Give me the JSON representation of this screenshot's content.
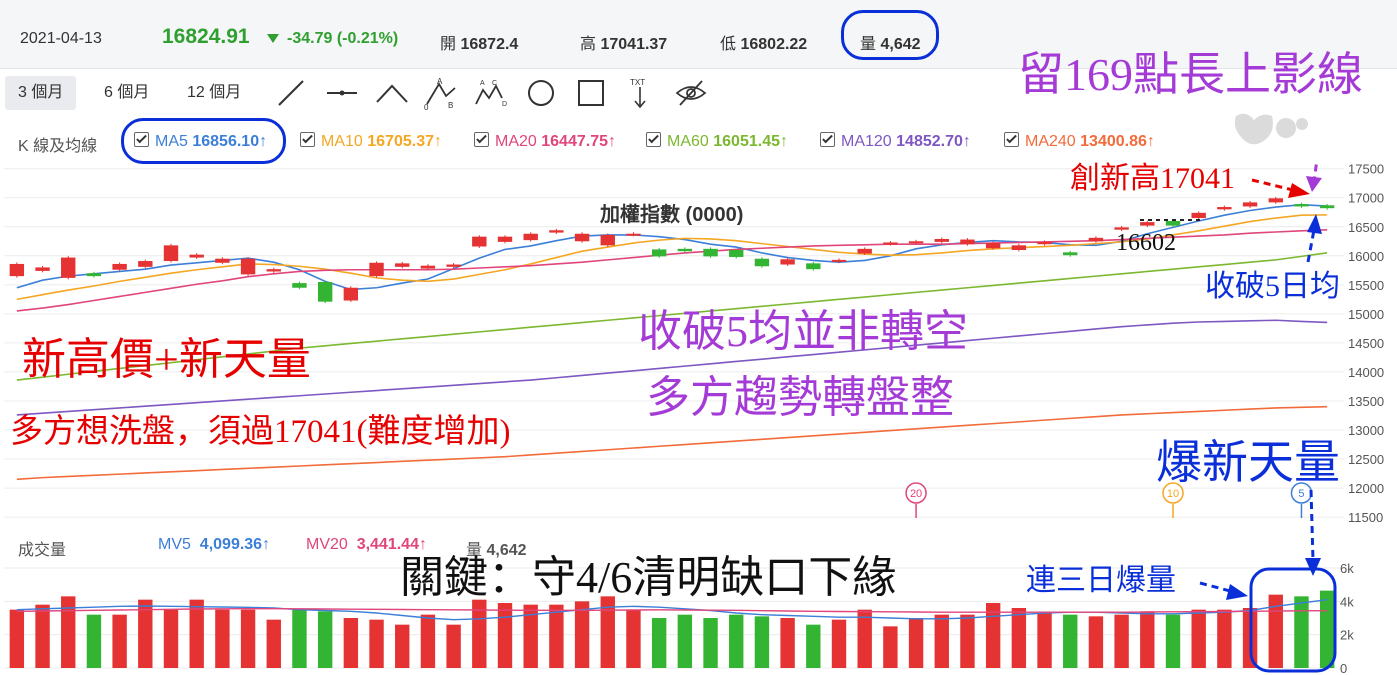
{
  "header": {
    "date": "2021-04-13",
    "price": "16824.91",
    "change": "-34.79 (-0.21%)",
    "open_label": "開",
    "open_value": "16872.4",
    "high_label": "高",
    "high_value": "17041.37",
    "low_label": "低",
    "low_value": "16802.22",
    "volume_label": "量",
    "volume_value": "4,642"
  },
  "toolbar": {
    "ranges": [
      "3 個月",
      "6 個月",
      "12 個月"
    ],
    "active_range": "3 個月",
    "tools": [
      "line-tool-icon",
      "horizontal-line-tool-icon",
      "angle-tool-icon",
      "abcd-pattern-tool-icon",
      "abcde-wave-tool-icon",
      "circle-tool-icon",
      "rectangle-tool-icon",
      "text-tool-icon",
      "hide-drawings-icon"
    ]
  },
  "ma_legend": {
    "title": "K 線及均線",
    "items": [
      {
        "label": "MA5",
        "value": "16856.10↑",
        "color": "#3c7fd8"
      },
      {
        "label": "MA10",
        "value": "16705.37↑",
        "color": "#f5a623"
      },
      {
        "label": "MA20",
        "value": "16447.75↑",
        "color": "#e0457b"
      },
      {
        "label": "MA60",
        "value": "16051.45↑",
        "color": "#7cb82f"
      },
      {
        "label": "MA120",
        "value": "14852.70↑",
        "color": "#7e57c2"
      },
      {
        "label": "MA240",
        "value": "13400.86↑",
        "color": "#f26b3a"
      }
    ]
  },
  "chart_data": {
    "type": "candlestick",
    "title": "加權指數 (0000)",
    "y_ticks": [
      11500,
      12000,
      12500,
      13000,
      13500,
      14000,
      14500,
      15000,
      15500,
      16000,
      16500,
      17000,
      17500
    ],
    "ylim": [
      11450,
      17650
    ],
    "candles": [
      {
        "o": 15650,
        "c": 15860
      },
      {
        "o": 15740,
        "c": 15800
      },
      {
        "o": 15620,
        "c": 15970
      },
      {
        "o": 15700,
        "c": 15650
      },
      {
        "o": 15760,
        "c": 15860
      },
      {
        "o": 15810,
        "c": 15910
      },
      {
        "o": 15910,
        "c": 16180
      },
      {
        "o": 15970,
        "c": 16020
      },
      {
        "o": 15880,
        "c": 15950
      },
      {
        "o": 15680,
        "c": 15950
      },
      {
        "o": 15730,
        "c": 15770
      },
      {
        "o": 15530,
        "c": 15450
      },
      {
        "o": 15550,
        "c": 15210
      },
      {
        "o": 15230,
        "c": 15450
      },
      {
        "o": 15650,
        "c": 15880
      },
      {
        "o": 15810,
        "c": 15870
      },
      {
        "o": 15780,
        "c": 15830
      },
      {
        "o": 15810,
        "c": 15850
      },
      {
        "o": 16160,
        "c": 16330
      },
      {
        "o": 16240,
        "c": 16330
      },
      {
        "o": 16270,
        "c": 16380
      },
      {
        "o": 16400,
        "c": 16440
      },
      {
        "o": 16250,
        "c": 16380
      },
      {
        "o": 16180,
        "c": 16360
      },
      {
        "o": 16360,
        "c": 16380
      },
      {
        "o": 16110,
        "c": 15990
      },
      {
        "o": 16120,
        "c": 16080
      },
      {
        "o": 16120,
        "c": 15990
      },
      {
        "o": 16100,
        "c": 15980
      },
      {
        "o": 15950,
        "c": 15820
      },
      {
        "o": 15850,
        "c": 15940
      },
      {
        "o": 15870,
        "c": 15770
      },
      {
        "o": 15900,
        "c": 15930
      },
      {
        "o": 16040,
        "c": 16120
      },
      {
        "o": 16200,
        "c": 16230
      },
      {
        "o": 16230,
        "c": 16250
      },
      {
        "o": 16240,
        "c": 16290
      },
      {
        "o": 16200,
        "c": 16280
      },
      {
        "o": 16130,
        "c": 16220
      },
      {
        "o": 16100,
        "c": 16180
      },
      {
        "o": 16200,
        "c": 16240
      },
      {
        "o": 16060,
        "c": 16010
      },
      {
        "o": 16250,
        "c": 16310
      },
      {
        "o": 16450,
        "c": 16490
      },
      {
        "o": 16520,
        "c": 16580
      },
      {
        "o": 16600,
        "c": 16520
      },
      {
        "o": 16650,
        "c": 16740
      },
      {
        "o": 16800,
        "c": 16840
      },
      {
        "o": 16850,
        "c": 16920
      },
      {
        "o": 16920,
        "c": 16990
      },
      {
        "o": 16890,
        "c": 16850
      },
      {
        "o": 16870,
        "c": 16820
      }
    ],
    "ma_lines": [
      {
        "name": "MA5",
        "color": "#3c7fd8",
        "values": [
          15450,
          15580,
          15650,
          15690,
          15730,
          15770,
          15840,
          15880,
          15920,
          15960,
          15890,
          15760,
          15560,
          15420,
          15450,
          15530,
          15600,
          15780,
          15960,
          16110,
          16170,
          16260,
          16340,
          16360,
          16360,
          16330,
          16280,
          16200,
          16150,
          16050,
          15970,
          15920,
          15890,
          15920,
          16000,
          16120,
          16190,
          16230,
          16260,
          16240,
          16230,
          16190,
          16180,
          16250,
          16380,
          16490,
          16600,
          16700,
          16780,
          16840,
          16880,
          16856
        ]
      },
      {
        "name": "MA10",
        "color": "#f5a623",
        "values": [
          15250,
          15330,
          15410,
          15480,
          15560,
          15630,
          15700,
          15760,
          15810,
          15860,
          15850,
          15820,
          15770,
          15700,
          15620,
          15580,
          15560,
          15600,
          15680,
          15760,
          15860,
          15970,
          16080,
          16150,
          16220,
          16270,
          16300,
          16290,
          16260,
          16210,
          16160,
          16110,
          16060,
          16030,
          16010,
          16020,
          16050,
          16090,
          16120,
          16140,
          16160,
          16180,
          16210,
          16240,
          16290,
          16360,
          16430,
          16510,
          16590,
          16650,
          16700,
          16705
        ]
      },
      {
        "name": "MA20",
        "color": "#e0457b",
        "values": [
          15050,
          15100,
          15160,
          15230,
          15300,
          15370,
          15440,
          15510,
          15570,
          15640,
          15690,
          15730,
          15750,
          15760,
          15760,
          15760,
          15760,
          15770,
          15790,
          15810,
          15830,
          15860,
          15890,
          15930,
          15970,
          16010,
          16050,
          16080,
          16110,
          16130,
          16150,
          16170,
          16180,
          16190,
          16200,
          16200,
          16200,
          16210,
          16220,
          16230,
          16240,
          16250,
          16260,
          16280,
          16300,
          16320,
          16340,
          16360,
          16390,
          16410,
          16430,
          16447
        ]
      },
      {
        "name": "MA60",
        "color": "#7cb82f",
        "values": [
          13860,
          13910,
          13960,
          14010,
          14060,
          14110,
          14160,
          14210,
          14260,
          14310,
          14360,
          14410,
          14450,
          14490,
          14530,
          14570,
          14610,
          14650,
          14690,
          14730,
          14770,
          14810,
          14850,
          14890,
          14930,
          14970,
          15010,
          15050,
          15090,
          15130,
          15170,
          15210,
          15250,
          15290,
          15330,
          15370,
          15410,
          15450,
          15490,
          15530,
          15570,
          15610,
          15650,
          15690,
          15730,
          15770,
          15810,
          15850,
          15890,
          15930,
          15990,
          16051
        ]
      },
      {
        "name": "MA120",
        "color": "#7e57c2",
        "values": [
          13260,
          13290,
          13320,
          13350,
          13380,
          13410,
          13440,
          13470,
          13500,
          13530,
          13560,
          13590,
          13620,
          13650,
          13680,
          13710,
          13740,
          13770,
          13800,
          13830,
          13860,
          13900,
          13940,
          13980,
          14020,
          14060,
          14100,
          14140,
          14180,
          14220,
          14260,
          14300,
          14340,
          14380,
          14420,
          14460,
          14500,
          14540,
          14580,
          14620,
          14660,
          14700,
          14740,
          14780,
          14810,
          14840,
          14860,
          14870,
          14880,
          14890,
          14870,
          14853
        ]
      },
      {
        "name": "MA240",
        "color": "#f26b3a",
        "values": [
          12150,
          12180,
          12200,
          12220,
          12240,
          12260,
          12280,
          12300,
          12320,
          12340,
          12360,
          12380,
          12400,
          12420,
          12440,
          12460,
          12480,
          12500,
          12520,
          12540,
          12570,
          12600,
          12630,
          12660,
          12690,
          12720,
          12750,
          12780,
          12810,
          12840,
          12870,
          12900,
          12930,
          12960,
          12990,
          13020,
          13050,
          13080,
          13110,
          13140,
          13170,
          13200,
          13230,
          13260,
          13280,
          13300,
          13320,
          13340,
          13360,
          13380,
          13390,
          13401
        ]
      }
    ],
    "markers": [
      {
        "label": "20",
        "index": 35,
        "color": "#e0457b"
      },
      {
        "label": "10",
        "index": 45,
        "color": "#f5a623"
      },
      {
        "label": "5",
        "index": 50,
        "color": "#3c7fd8"
      }
    ],
    "volume": {
      "title": "成交量",
      "y_ticks": [
        "6k",
        "4k",
        "2k",
        "0"
      ],
      "ylim": [
        0,
        6000
      ],
      "mv5_label": "MV5",
      "mv5_value": "4,099.36↑",
      "mv20_label": "MV20",
      "mv20_value": "3,441.44↑",
      "vol_label": "量",
      "vol_value": "4,642",
      "bars": [
        3500,
        3800,
        4300,
        3200,
        3200,
        4100,
        3500,
        4100,
        3500,
        3500,
        2900,
        3500,
        3400,
        3000,
        2900,
        2600,
        3200,
        2600,
        4100,
        3900,
        3800,
        3800,
        4000,
        4300,
        3500,
        3000,
        3200,
        3000,
        3200,
        3100,
        3000,
        2600,
        2900,
        3500,
        2500,
        3000,
        3200,
        3200,
        3900,
        3600,
        3300,
        3200,
        3100,
        3200,
        3400,
        3200,
        3500,
        3500,
        3600,
        4400,
        4300,
        4642
      ],
      "mv5": [
        3500,
        3550,
        3600,
        3650,
        3700,
        3720,
        3700,
        3680,
        3660,
        3640,
        3600,
        3500,
        3450,
        3400,
        3300,
        3150,
        3000,
        2900,
        2950,
        3050,
        3200,
        3350,
        3500,
        3650,
        3700,
        3650,
        3550,
        3450,
        3300,
        3200,
        3150,
        3100,
        3050,
        3050,
        3000,
        2950,
        2950,
        3000,
        3100,
        3200,
        3300,
        3350,
        3350,
        3300,
        3250,
        3250,
        3300,
        3350,
        3450,
        3700,
        3900,
        4099
      ],
      "mv20": [
        3400,
        3420,
        3440,
        3460,
        3480,
        3500,
        3520,
        3540,
        3550,
        3560,
        3560,
        3550,
        3540,
        3530,
        3520,
        3510,
        3500,
        3490,
        3480,
        3470,
        3460,
        3460,
        3460,
        3470,
        3480,
        3490,
        3480,
        3470,
        3460,
        3440,
        3420,
        3400,
        3390,
        3380,
        3370,
        3360,
        3350,
        3350,
        3350,
        3350,
        3350,
        3350,
        3350,
        3350,
        3360,
        3370,
        3380,
        3390,
        3400,
        3420,
        3430,
        3441
      ]
    }
  },
  "annotations": {
    "upper_shadow": "留169點長上影線",
    "new_high": "創新高17041",
    "low_point": "16602",
    "break_ma5": "收破5日均",
    "new_high_volume_red": "新高價+新天量",
    "not_bearish": "收破5均並非轉空",
    "consolidation": "多方趨勢轉盤整",
    "washout": "多方想洗盤，須過17041(難度增加)",
    "big_volume": "爆新天量",
    "key_gap": "關鍵：守4/6清明缺口下緣",
    "three_days": "連三日爆量"
  },
  "colors": {
    "up": "#e53333",
    "down": "#33b533",
    "annotation_red": "#e60000",
    "annotation_purple": "#a43bd6",
    "annotation_blue": "#0a2fd9",
    "highlight_blue": "#0a2fd9"
  }
}
